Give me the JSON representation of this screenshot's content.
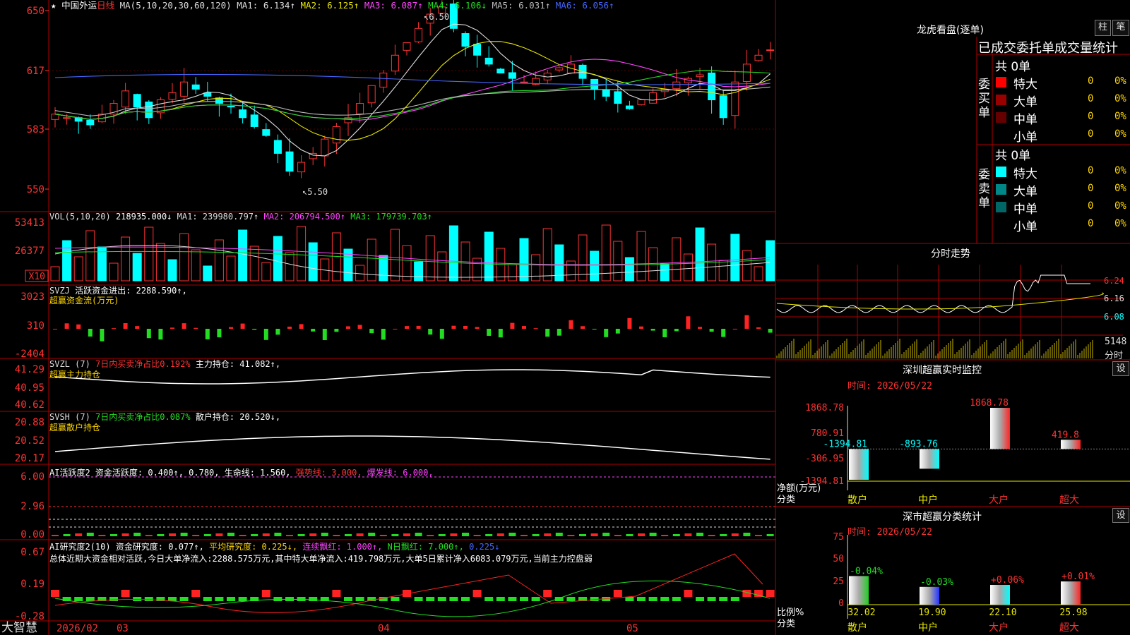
{
  "stock": {
    "name": "中国外运",
    "period": "日线",
    "star": "★"
  },
  "ma_header": {
    "label": "MA(5,10,20,30,60,120)",
    "items": [
      {
        "text": "MA1: 6.134↑",
        "color": "#dddddd"
      },
      {
        "text": "MA2: 6.125↑",
        "color": "#e6e600"
      },
      {
        "text": "MA3: 6.087↑",
        "color": "#ff44ff"
      },
      {
        "text": "MA4: 6.106↓",
        "color": "#22dd22"
      },
      {
        "text": "MA5: 6.031↑",
        "color": "#bbbbbb"
      },
      {
        "text": "MA6: 6.056↑",
        "color": "#4466ff"
      }
    ]
  },
  "price_axis": [
    "650",
    "617",
    "583",
    "550"
  ],
  "price_marks": {
    "high": "6.50",
    "low": "5.50"
  },
  "vol": {
    "label": "VOL(5,10,20)",
    "value": "218935.000↓",
    "items": [
      {
        "text": "MA1: 239980.797↑",
        "color": "#dddddd"
      },
      {
        "text": "MA2: 206794.500↑",
        "color": "#ff44ff"
      },
      {
        "text": "MA3: 179739.703↑",
        "color": "#22dd22"
      }
    ],
    "axis": [
      "53413",
      "26377"
    ],
    "unit": "X10"
  },
  "svzj": {
    "name": "SVZJ",
    "label": "活跃资金进出: 2288.590↑,",
    "sub": "超赢资金流(万元)",
    "axis": [
      "3023",
      "310",
      "-2404"
    ]
  },
  "svzl": {
    "name": "SVZL (7)",
    "ratio": "7日内买卖净占比0.192%",
    "hold": "主力持仓: 41.082↑,",
    "sub": "超赢主力持仓",
    "axis": [
      "41.29",
      "40.95",
      "40.62"
    ]
  },
  "svsh": {
    "name": "SVSH (7)",
    "ratio": "7日内买卖净占比0.087%",
    "hold": "散户持仓: 20.520↓,",
    "sub": "超赢散户持仓",
    "axis": [
      "20.88",
      "20.52",
      "20.17"
    ]
  },
  "ai2": {
    "label": "AI活跃度2 资金活跃度: 0.400↑, 0.780, 生命线: 1.560,",
    "strong": "强势线: 3.000,",
    "burst": "爆发线: 6.000,",
    "axis": [
      "6.00",
      "2.96",
      "0.00"
    ]
  },
  "ai_res": {
    "label": "AI研究度2(10) 资金研究度: 0.077↑,",
    "avg": "平均研究度: 0.225↓,",
    "red": "连续飘红: 1.000↑,",
    "nred": "N日飘红: 7.000↑,",
    "last": "0.225↓",
    "summary": "总体近期大资金相对活跃,今日大单净流入:2288.575万元,其中特大单净流入:419.798万元,大单5日累计净入6083.079万元,当前主力控盘弱",
    "axis": [
      "0.67",
      "0.19",
      "-0.28"
    ]
  },
  "date_axis": {
    "brand": "大智慧",
    "labels": [
      "2026/02",
      "03",
      "04",
      "05"
    ]
  },
  "dragon": {
    "title": "龙虎看盘(逐单)",
    "btn1": "柱",
    "btn2": "笔",
    "header": "已成交委托单成交量统计",
    "buy": {
      "label": "委买单",
      "total": "共 0单",
      "rows": [
        {
          "name": "特大",
          "v1": "0",
          "v2": "0%",
          "color": "#ff0000"
        },
        {
          "name": "大单",
          "v1": "0",
          "v2": "0%",
          "color": "#990000"
        },
        {
          "name": "中单",
          "v1": "0",
          "v2": "0%",
          "color": "#660000"
        },
        {
          "name": "小单",
          "v1": "0",
          "v2": "0%",
          "color": "#000000"
        }
      ]
    },
    "sell": {
      "label": "委卖单",
      "total": "共 0单",
      "rows": [
        {
          "name": "特大",
          "v1": "0",
          "v2": "0%",
          "color": "#00ffff"
        },
        {
          "name": "大单",
          "v1": "0",
          "v2": "0%",
          "color": "#008888"
        },
        {
          "name": "中单",
          "v1": "0",
          "v2": "0%",
          "color": "#006666"
        },
        {
          "name": "小单",
          "v1": "0",
          "v2": "0%",
          "color": "#000000"
        }
      ]
    }
  },
  "fenshi": {
    "title": "分时走势",
    "axis": [
      "6.24",
      "6.16",
      "6.08"
    ],
    "vol_label": "5148",
    "vol_unit": "分时"
  },
  "monitor": {
    "title": "深圳超赢实时监控",
    "settings": "设",
    "time": "时间: 2026/05/22",
    "axis": [
      "1868.78",
      "780.91",
      "-306.95",
      "-1394.81"
    ],
    "ylabel": "净额(万元)",
    "xlabel": "分类",
    "chart_data": {
      "type": "bar",
      "categories": [
        "散户",
        "中户",
        "大户",
        "超大"
      ],
      "values": [
        -1394.81,
        -893.76,
        1868.78,
        419.8
      ],
      "labels": [
        "-1394.81",
        "-893.76",
        "1868.78",
        "419.8"
      ],
      "ylim": [
        -1394.81,
        1868.78
      ]
    }
  },
  "classify": {
    "title": "深市超赢分类统计",
    "settings": "设",
    "time": "时间: 2026/05/22",
    "axis": [
      "75",
      "50",
      "25",
      "0"
    ],
    "ylabel": "比例%",
    "xlabel": "分类",
    "chart_data": {
      "type": "bar",
      "categories": [
        "散户",
        "中户",
        "大户",
        "超大"
      ],
      "values": [
        32.02,
        19.9,
        22.1,
        25.98
      ],
      "changes": [
        "-0.04%",
        "-0.03%",
        "+0.06%",
        "+0.01%"
      ],
      "ylim": [
        0,
        75
      ],
      "colors": [
        "#22cc22",
        "#2233ff",
        "#00ffff",
        "#ff2222"
      ]
    }
  }
}
